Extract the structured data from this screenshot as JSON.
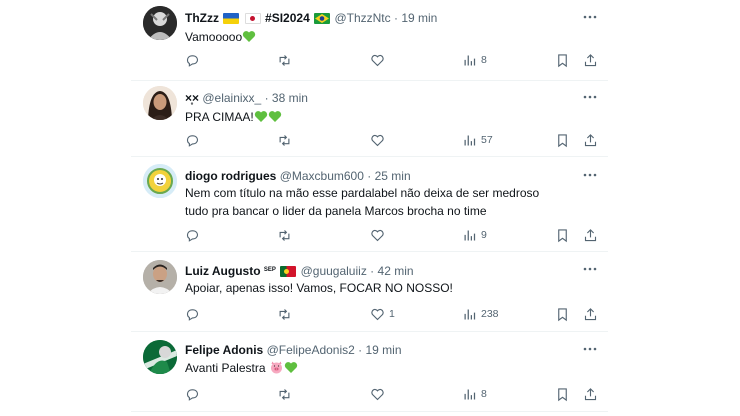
{
  "posts": [
    {
      "display_name": "ThZzz",
      "display_name_tag": "#SI2024",
      "handle": "@ThzzNtc",
      "time": "19 min",
      "text": "Vamooooo",
      "emojis": [
        "green-heart"
      ],
      "flags": [
        "ukraine-flag",
        "japan-flag",
        "brazil-flag"
      ],
      "views": "8",
      "replies": "",
      "reposts": "",
      "likes": ""
    },
    {
      "display_name": "×̥×",
      "handle": "@elainixx_",
      "time": "38 min",
      "text": "PRA CIMAA!",
      "emojis": [
        "green-heart",
        "green-heart"
      ],
      "views": "57",
      "replies": "",
      "reposts": "",
      "likes": ""
    },
    {
      "display_name": "diogo rodrigues",
      "handle": "@Maxcbum600",
      "time": "25 min",
      "text": "Nem com título na mão esse pardalabel não deixa de ser medroso tudo pra bancar o lider da panela Marcos brocha no time",
      "views": "9",
      "replies": "",
      "reposts": "",
      "likes": ""
    },
    {
      "display_name": "Luiz Augusto",
      "display_name_tag": "SEP",
      "handle": "@guugaluiiz",
      "time": "42 min",
      "text": "Apoiar, apenas isso! Vamos, FOCAR NO NOSSO!",
      "flags": [
        "portugal-flag"
      ],
      "views": "238",
      "replies": "",
      "reposts": "",
      "likes": "1"
    },
    {
      "display_name": "Felipe Adonis",
      "handle": "@FelipeAdonis2",
      "time": "19 min",
      "text": "Avanti Palestra ",
      "emojis": [
        "pig-face",
        "green-heart"
      ],
      "views": "8",
      "replies": "",
      "reposts": "",
      "likes": ""
    }
  ],
  "separator": "·",
  "colors": {
    "text": "#0f1419",
    "secondary": "#536471",
    "divider": "#eff3f4",
    "heart_green": "#5fbf3f"
  }
}
